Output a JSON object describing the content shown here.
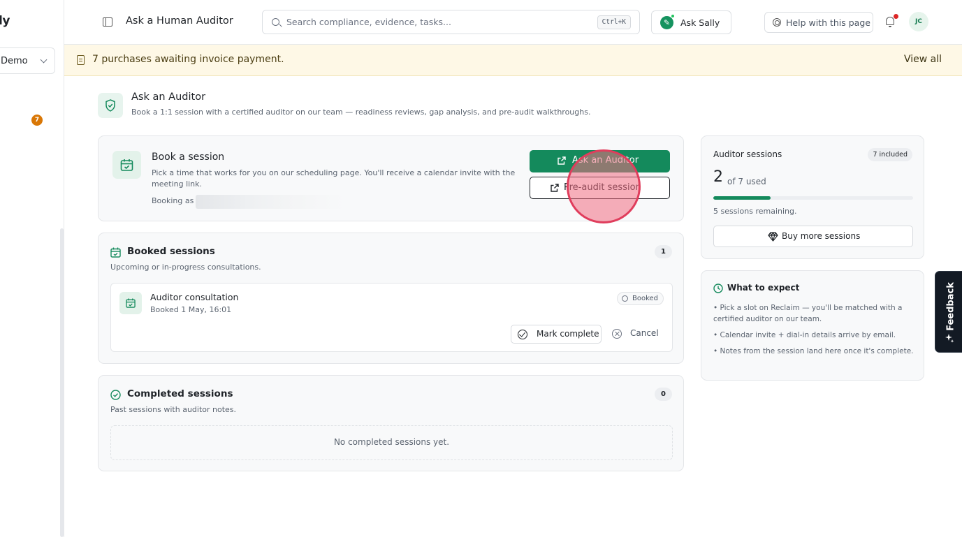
{
  "sidebar": {
    "logo_text": "ly",
    "org_name": "Demo",
    "badge_count": "7"
  },
  "topbar": {
    "page_title": "Ask a Human Auditor",
    "search_placeholder": "Search compliance, evidence, tasks...",
    "search_shortcut": "Ctrl+K",
    "ask_sally_label": "Ask Sally",
    "help_label": "Help with this page",
    "avatar_initials": "JC"
  },
  "banner": {
    "text": "7 purchases awaiting invoice payment.",
    "link": "View all"
  },
  "header": {
    "title": "Ask an Auditor",
    "subtitle": "Book a 1:1 session with a certified auditor on our team — readiness reviews, gap analysis, and pre-audit walkthroughs."
  },
  "book": {
    "title": "Book a session",
    "description": "Pick a time that works for you on our scheduling page. You'll receive a calendar invite with the meeting link.",
    "booking_as": "Booking as",
    "primary_button": "Ask an Auditor",
    "secondary_button": "Pre-audit session"
  },
  "booked": {
    "title": "Booked sessions",
    "subtitle": "Upcoming or in-progress consultations.",
    "count": "1",
    "items": [
      {
        "title": "Auditor consultation",
        "date": "Booked 1 May, 16:01",
        "status": "Booked",
        "complete_label": "Mark complete",
        "cancel_label": "Cancel"
      }
    ]
  },
  "completed": {
    "title": "Completed sessions",
    "subtitle": "Past sessions with auditor notes.",
    "count": "0",
    "empty_text": "No completed sessions yet."
  },
  "credits": {
    "title": "Auditor sessions",
    "included": "7 included",
    "used": "2",
    "of_text": "of 7 used",
    "used_fraction": 0.2857,
    "remaining": "5 sessions remaining.",
    "buy_label": "Buy more sessions"
  },
  "expect": {
    "title": "What to expect",
    "items": [
      "• Pick a slot on Reclaim — you'll be matched with a certified auditor on our team.",
      "• Calendar invite + dial-in details arrive by email.",
      "• Notes from the session land here once it's complete."
    ]
  },
  "feedback": {
    "label": "Feedback"
  },
  "colors": {
    "accent": "#148a5c",
    "banner_bg": "#fef8e6",
    "notification": "#dc2626",
    "badge": "#d97706"
  }
}
